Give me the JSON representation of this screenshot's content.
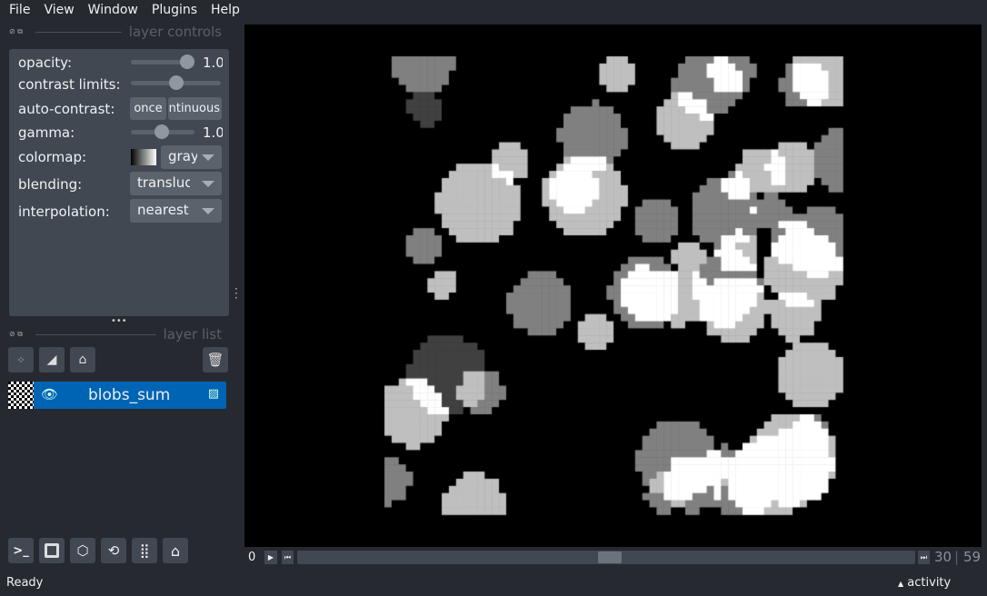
{
  "menu": [
    "File",
    "View",
    "Window",
    "Plugins",
    "Help"
  ],
  "layer_controls": {
    "title": "layer controls",
    "opacity": {
      "label": "opacity:",
      "value": "1.0",
      "fraction": 1.0
    },
    "contrast_limits": {
      "label": "contrast limits:"
    },
    "auto_contrast": {
      "label": "auto-contrast:",
      "once": "once",
      "continuous": "continuous"
    },
    "gamma": {
      "label": "gamma:",
      "value": "1.0",
      "fraction": 0.5
    },
    "colormap": {
      "label": "colormap:",
      "value": "gray"
    },
    "blending": {
      "label": "blending:",
      "value": "translucent"
    },
    "interpolation": {
      "label": "interpolation:",
      "value": "nearest"
    }
  },
  "layer_list": {
    "title": "layer list",
    "layers": [
      {
        "name": "blobs_sum",
        "visible": true,
        "type": "image",
        "selected": true
      }
    ]
  },
  "dims": {
    "current": "30",
    "min": "0",
    "max": "59"
  },
  "status": {
    "text": "Ready",
    "activity": "activity"
  },
  "colors": {
    "accent": "#0064b4",
    "panel": "#414851",
    "background": "#262930"
  }
}
